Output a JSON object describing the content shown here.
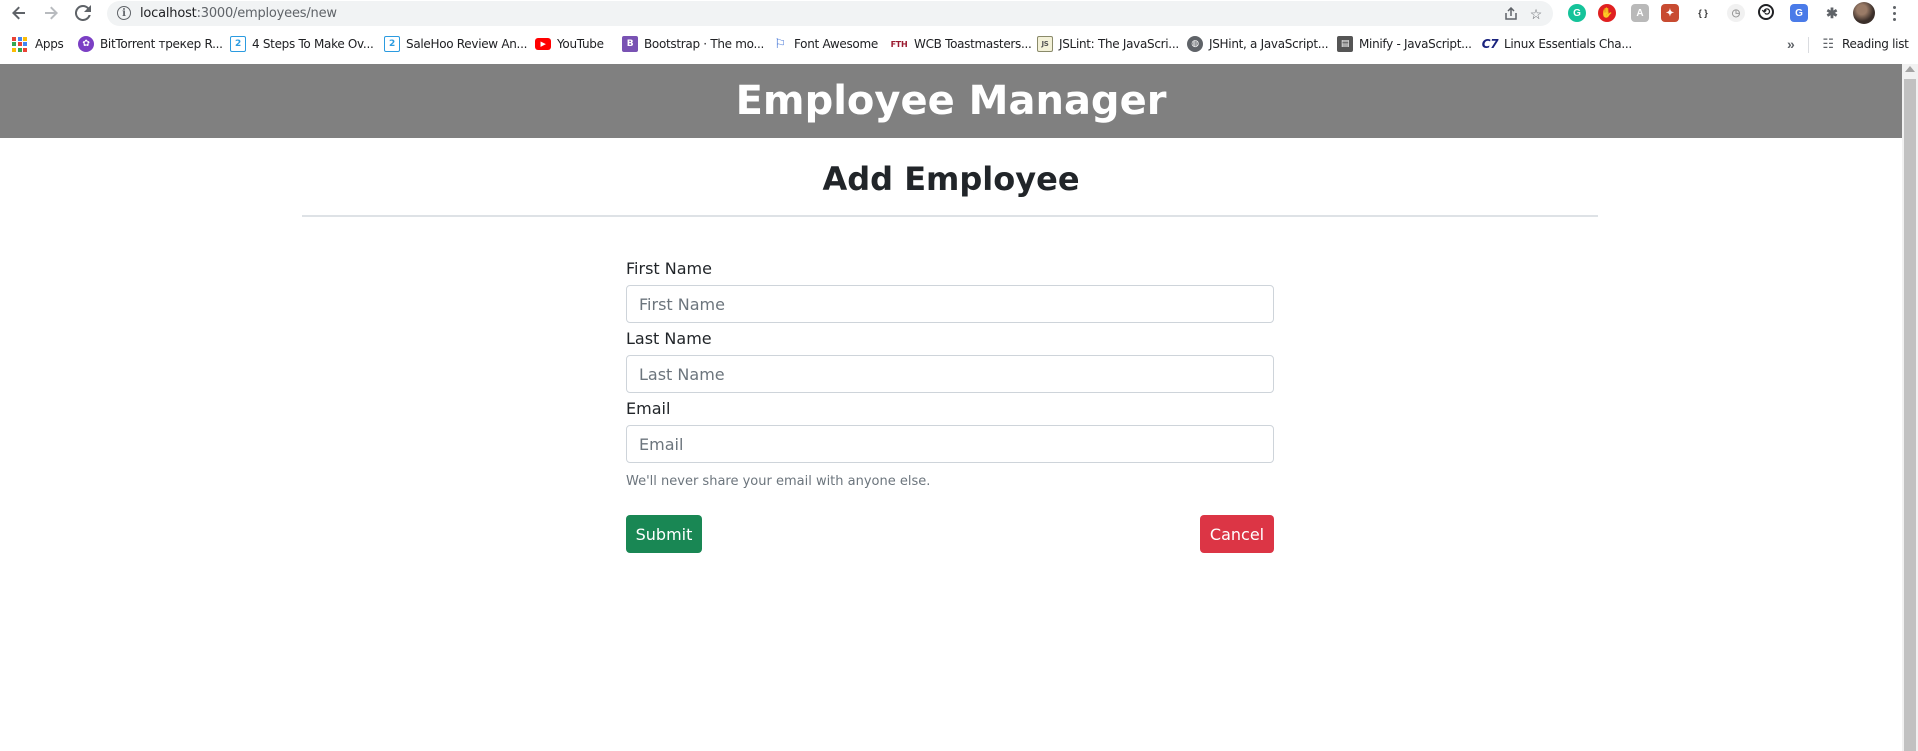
{
  "browser": {
    "url_host": "localhost",
    "url_path": ":3000/employees/new",
    "bookmarks": [
      {
        "label": "Apps",
        "icon": "apps-grid-icon"
      },
      {
        "label": "BitTorrent трекер R...",
        "icon": "bittorrent-icon",
        "color": "#7b3fc4"
      },
      {
        "label": "4 Steps To Make Ov...",
        "icon": "saleshoo-icon",
        "color": "#2b9be0"
      },
      {
        "label": "SaleHoo Review An...",
        "icon": "saleshoo-icon",
        "color": "#2b9be0"
      },
      {
        "label": "YouTube",
        "icon": "youtube-icon",
        "color": "#ff0000"
      },
      {
        "label": "Bootstrap · The mo...",
        "icon": "bootstrap-icon",
        "color": "#7952b3"
      },
      {
        "label": "Font Awesome",
        "icon": "flag-icon",
        "color": "#3b6fd4"
      },
      {
        "label": "WCB Toastmasters...",
        "icon": "fth-icon",
        "color": "#9b1b30"
      },
      {
        "label": "JSLint: The JavaScri...",
        "icon": "jslint-icon",
        "color": "#8a8a6a"
      },
      {
        "label": "JSHint, a JavaScript...",
        "icon": "globe-icon",
        "color": "#5f6368"
      },
      {
        "label": "Minify - JavaScript...",
        "icon": "minify-icon",
        "color": "#555555"
      },
      {
        "label": "Linux Essentials Cha...",
        "icon": "c7-icon",
        "color": "#1a237e"
      }
    ],
    "reading_list": "Reading list",
    "chevrons": "»"
  },
  "app": {
    "title": "Employee Manager"
  },
  "page": {
    "heading": "Add Employee"
  },
  "form": {
    "first_name": {
      "label": "First Name",
      "placeholder": "First Name",
      "value": ""
    },
    "last_name": {
      "label": "Last Name",
      "placeholder": "Last Name",
      "value": ""
    },
    "email": {
      "label": "Email",
      "placeholder": "Email",
      "value": "",
      "help": "We'll never share your email with anyone else."
    },
    "submit_label": "Submit",
    "cancel_label": "Cancel"
  },
  "colors": {
    "header_band": "#808080",
    "submit": "#198754",
    "cancel": "#dc3545"
  }
}
